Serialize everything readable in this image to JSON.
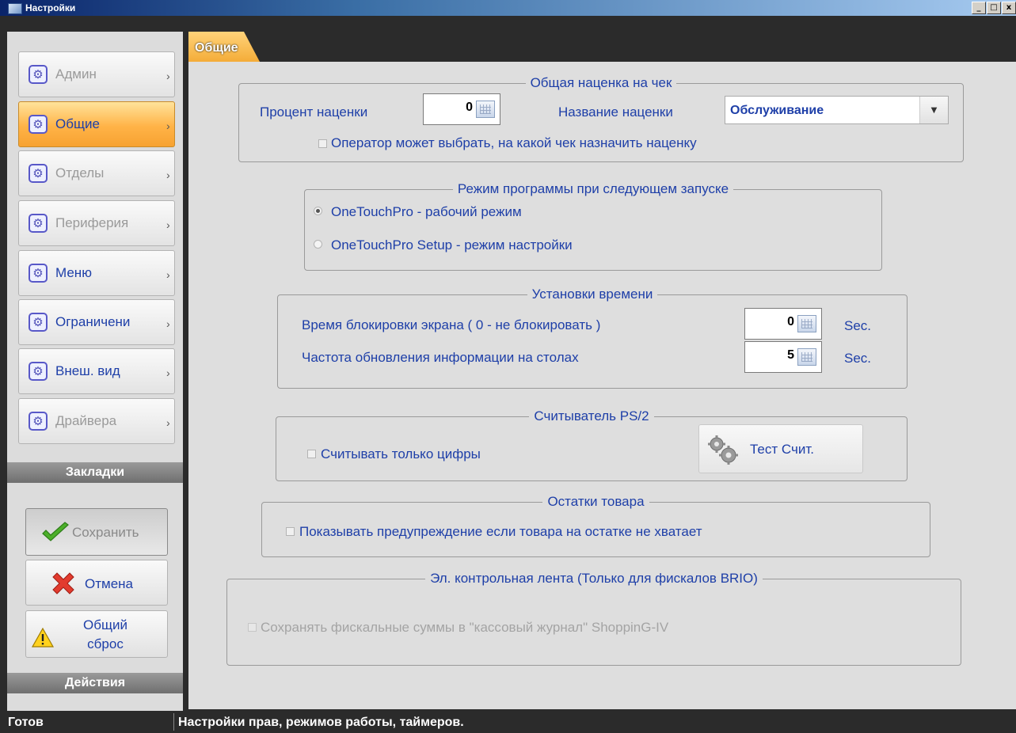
{
  "window": {
    "title": "Настройки",
    "controls": [
      "_",
      "□",
      "x"
    ]
  },
  "sidebar": {
    "items": [
      {
        "label": "Админ",
        "state": "disabled"
      },
      {
        "label": "Общие",
        "state": "active"
      },
      {
        "label": "Отделы",
        "state": "disabled"
      },
      {
        "label": "Периферия",
        "state": "disabled"
      },
      {
        "label": "Меню",
        "state": "normal"
      },
      {
        "label": "Ограничени",
        "state": "normal"
      },
      {
        "label": "Внеш. вид",
        "state": "normal"
      },
      {
        "label": "Драйвера",
        "state": "disabled"
      }
    ],
    "arrow": "›",
    "bookmarks_header": "Закладки",
    "actions_header": "Действия",
    "actions": {
      "save": "Сохранить",
      "cancel": "Отмена",
      "reset_line1": "Общий",
      "reset_line2": "сброс"
    }
  },
  "tabs": [
    {
      "label": "Общие",
      "active": true
    }
  ],
  "groups": {
    "markup": {
      "title": "Общая наценка на чек",
      "percent_label": "Процент наценки",
      "percent_value": "0",
      "name_label": "Название наценки",
      "name_value": "Обслуживание",
      "operator_choice": "Оператор может выбрать, на какой чек назначить наценку",
      "operator_choice_checked": false
    },
    "mode": {
      "title": "Режим программы при следующем запуске",
      "option_work": "OneTouchPro - рабочий режим",
      "option_setup": "OneTouchPro Setup - режим настройки",
      "selected": "work"
    },
    "time": {
      "title": "Установки времени",
      "lock_label": "Время блокировки экрана ( 0 - не блокировать )",
      "lock_value": "0",
      "refresh_label": "Частота обновления информации на столах",
      "refresh_value": "5",
      "unit": "Sec."
    },
    "reader": {
      "title": "Считыватель PS/2",
      "digits_only": "Считывать только цифры",
      "digits_only_checked": false,
      "test_button": "Тест Счит."
    },
    "stock": {
      "title": "Остатки товара",
      "warn": "Показывать предупреждение если товара на остатке не хватает",
      "warn_checked": false
    },
    "ecl": {
      "title": "Эл. контрольная лента (Только для фискалов BRIO)",
      "save_sums": "Сохранять фискальные суммы в \"кассовый журнал\" ShoppinG-IV",
      "save_sums_checked": false,
      "enabled": false
    }
  },
  "status": {
    "left": "Готов",
    "right": "Настройки прав, режимов работы, таймеров."
  },
  "colors": {
    "accent": "#f4ac38",
    "label_blue": "#1e3fa8",
    "panel_bg": "#dedede",
    "dark_bg": "#2b2b2b",
    "cancel_red": "#e23b2e",
    "save_green": "#4caf2a"
  }
}
